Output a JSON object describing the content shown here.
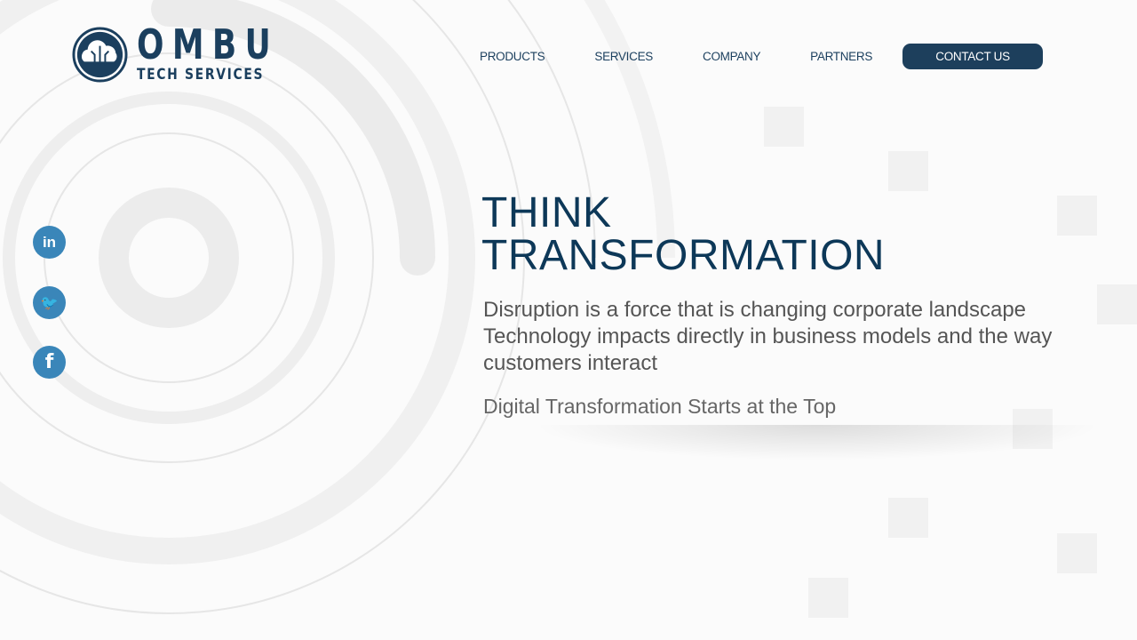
{
  "brand": {
    "name": "OMBU",
    "tagline": "TECH SERVICES",
    "color": "#1b3f5e"
  },
  "nav": {
    "items": [
      "PRODUCTS",
      "SERVICES",
      "COMPANY",
      "PARTNERS"
    ],
    "contact": "CONTACT US"
  },
  "social": [
    {
      "icon": "linkedin-icon",
      "glyph": "in"
    },
    {
      "icon": "twitter-icon",
      "glyph": "🐦"
    },
    {
      "icon": "facebook-icon",
      "glyph": "f"
    }
  ],
  "hero": {
    "title_line1": "THINK",
    "title_line2": "TRANSFORMATION",
    "description_line1": "Disruption is a force that is changing corporate landscape",
    "description_line2": "Technology impacts directly in business models and the way",
    "description_line3": "customers interact",
    "tagline": "Digital Transformation Starts at the Top"
  }
}
